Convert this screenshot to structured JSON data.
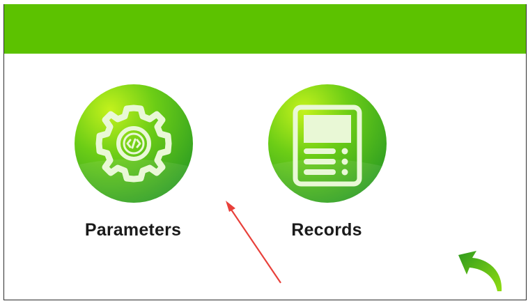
{
  "header": {
    "bar_color": "#5cc200"
  },
  "menu": {
    "items": [
      {
        "label": "Parameters",
        "icon": "gear-code-icon"
      },
      {
        "label": "Records",
        "icon": "records-list-icon"
      }
    ]
  },
  "navigation": {
    "back_icon": "back-arrow-icon"
  },
  "annotation": {
    "arrow_color": "#e8403a"
  },
  "colors": {
    "accent_green": "#5cc200",
    "icon_green_light": "#b6ee1a",
    "icon_green_dark": "#2ea51e"
  }
}
